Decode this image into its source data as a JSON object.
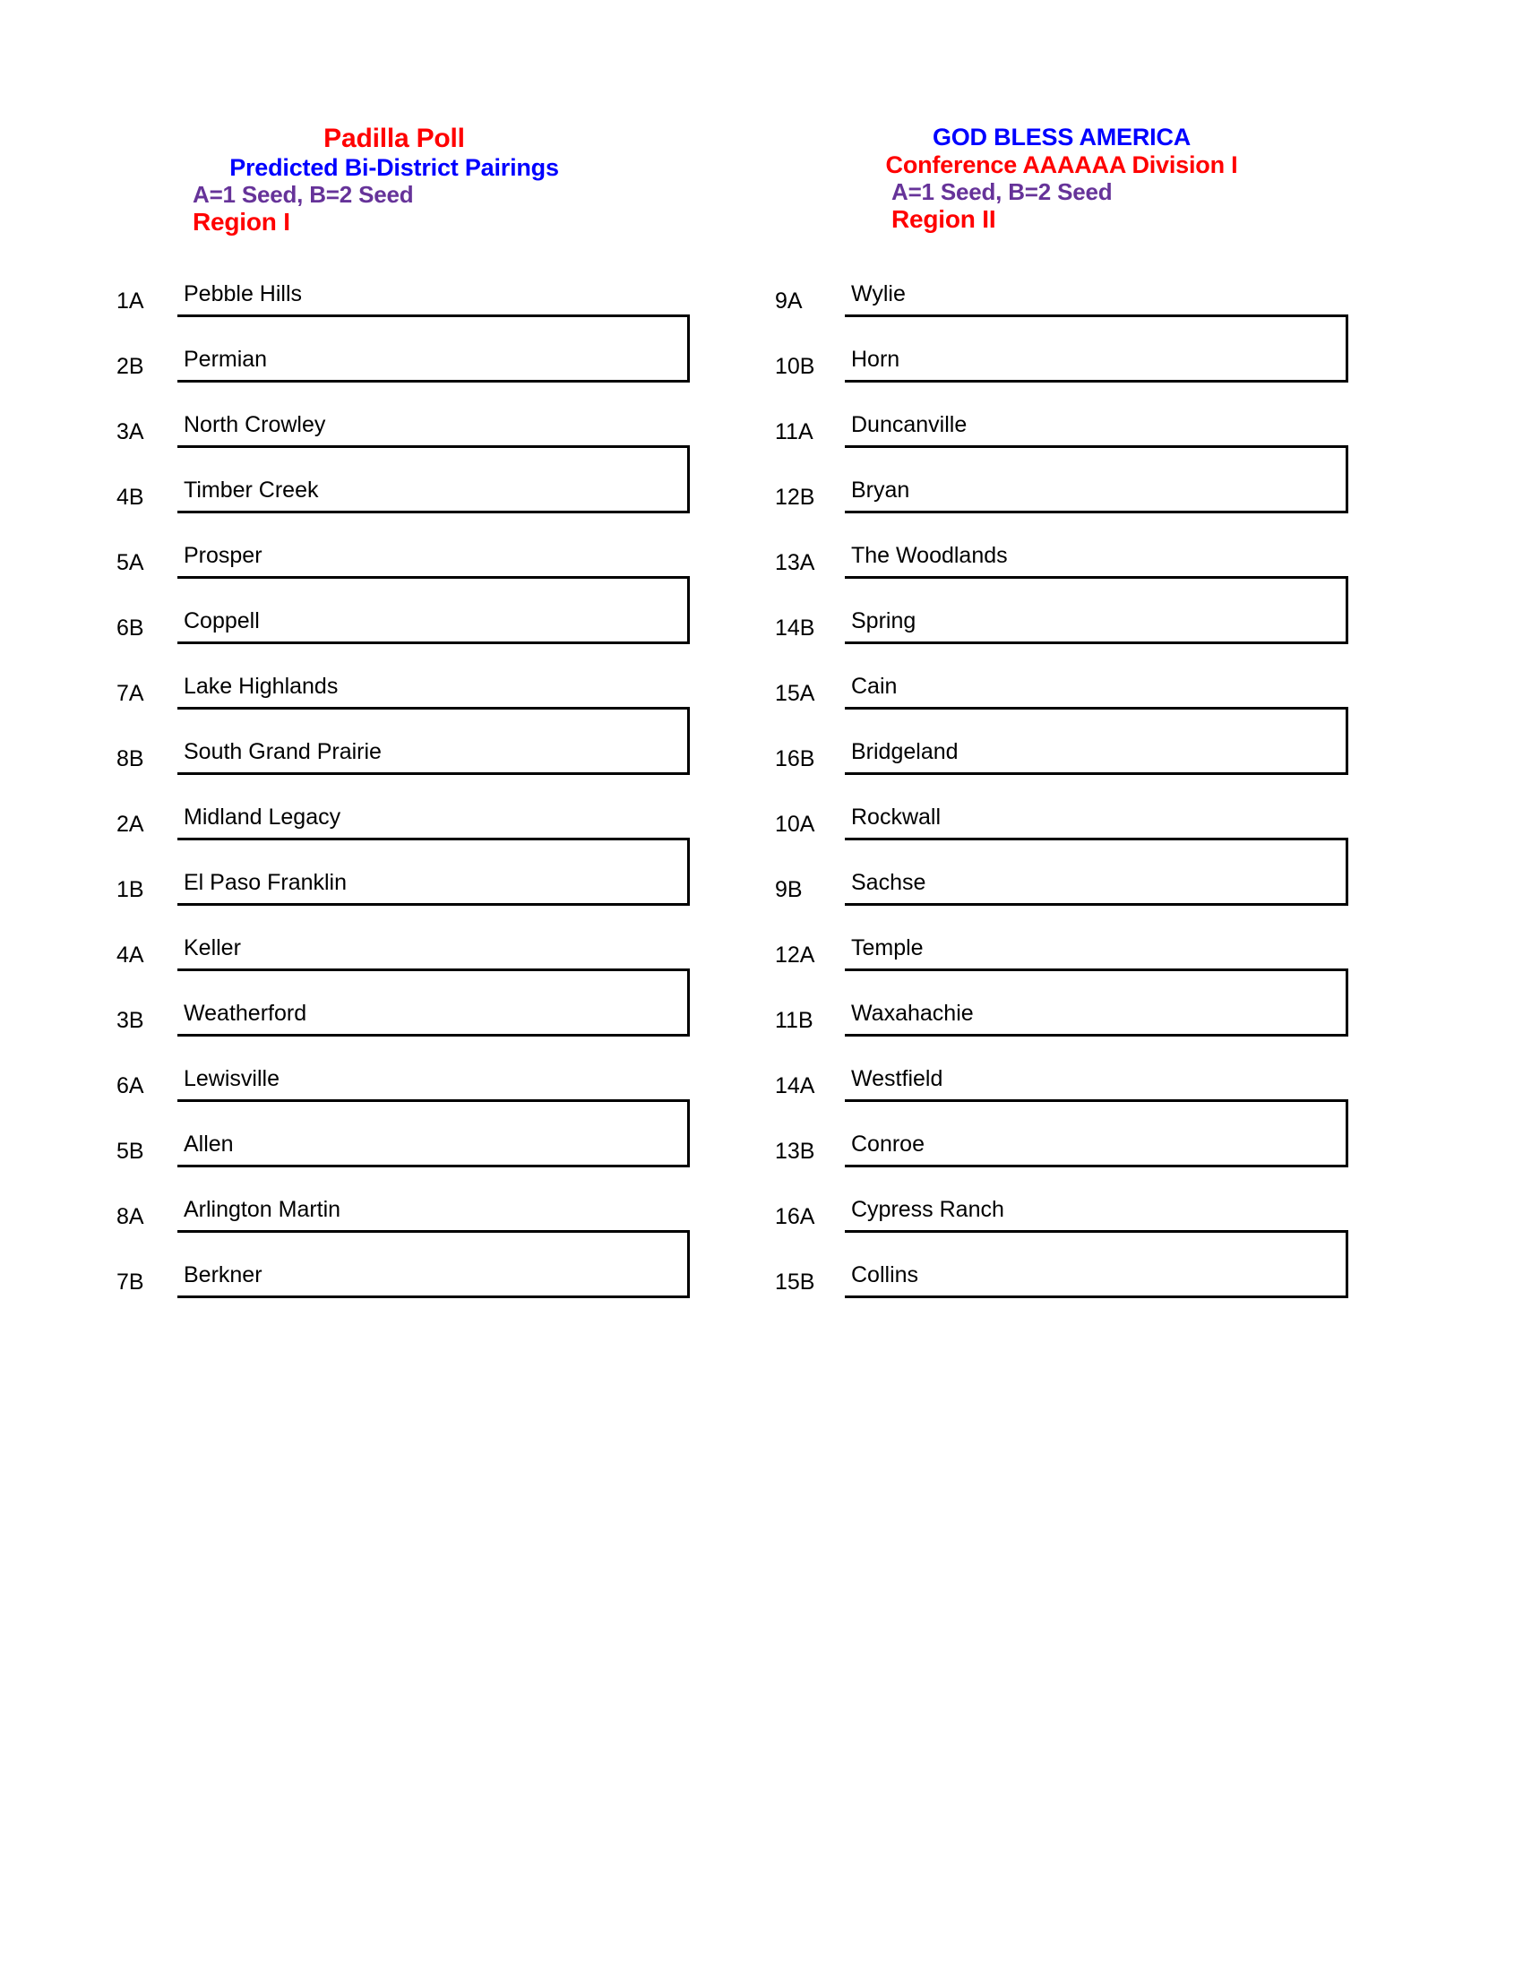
{
  "document": {
    "type": "bracket-sheet",
    "colors": {
      "title_red": "#FF0000",
      "subtitle_blue": "#0000FF",
      "seed_purple": "#663399",
      "text_black": "#000000",
      "background": "#FFFFFF"
    }
  },
  "columns": [
    {
      "id": "region-1",
      "headings": {
        "title": "Padilla Poll",
        "subtitle": "Predicted Bi-District Pairings",
        "seed_legend": "A=1 Seed, B=2 Seed",
        "region": "Region I"
      },
      "pairs": [
        {
          "top": {
            "seed": "1A",
            "team": "Pebble Hills"
          },
          "bottom": {
            "seed": "2B",
            "team": "Permian"
          }
        },
        {
          "top": {
            "seed": "3A",
            "team": "North Crowley"
          },
          "bottom": {
            "seed": "4B",
            "team": "Timber Creek"
          }
        },
        {
          "top": {
            "seed": "5A",
            "team": "Prosper"
          },
          "bottom": {
            "seed": "6B",
            "team": "Coppell"
          }
        },
        {
          "top": {
            "seed": "7A",
            "team": "Lake Highlands"
          },
          "bottom": {
            "seed": "8B",
            "team": "South Grand Prairie"
          }
        },
        {
          "top": {
            "seed": "2A",
            "team": "Midland Legacy"
          },
          "bottom": {
            "seed": "1B",
            "team": "El Paso Franklin"
          }
        },
        {
          "top": {
            "seed": "4A",
            "team": "Keller"
          },
          "bottom": {
            "seed": "3B",
            "team": "Weatherford"
          }
        },
        {
          "top": {
            "seed": "6A",
            "team": "Lewisville"
          },
          "bottom": {
            "seed": "5B",
            "team": "Allen"
          }
        },
        {
          "top": {
            "seed": "8A",
            "team": "Arlington Martin"
          },
          "bottom": {
            "seed": "7B",
            "team": "Berkner"
          }
        }
      ]
    },
    {
      "id": "region-2",
      "headings": {
        "title": "GOD BLESS AMERICA",
        "subtitle": "Conference AAAAAA Division I",
        "seed_legend": "A=1 Seed, B=2 Seed",
        "region": "Region II"
      },
      "pairs": [
        {
          "top": {
            "seed": "9A",
            "team": "Wylie"
          },
          "bottom": {
            "seed": "10B",
            "team": "Horn"
          }
        },
        {
          "top": {
            "seed": "11A",
            "team": "Duncanville"
          },
          "bottom": {
            "seed": "12B",
            "team": "Bryan"
          }
        },
        {
          "top": {
            "seed": "13A",
            "team": "The Woodlands"
          },
          "bottom": {
            "seed": "14B",
            "team": "Spring"
          }
        },
        {
          "top": {
            "seed": "15A",
            "team": "Cain"
          },
          "bottom": {
            "seed": "16B",
            "team": "Bridgeland"
          }
        },
        {
          "top": {
            "seed": "10A",
            "team": "Rockwall"
          },
          "bottom": {
            "seed": "9B",
            "team": "Sachse"
          }
        },
        {
          "top": {
            "seed": "12A",
            "team": "Temple"
          },
          "bottom": {
            "seed": "11B",
            "team": "Waxahachie"
          }
        },
        {
          "top": {
            "seed": "14A",
            "team": "Westfield"
          },
          "bottom": {
            "seed": "13B",
            "team": "Conroe"
          }
        },
        {
          "top": {
            "seed": "16A",
            "team": "Cypress Ranch"
          },
          "bottom": {
            "seed": "15B",
            "team": "Collins"
          }
        }
      ]
    }
  ]
}
